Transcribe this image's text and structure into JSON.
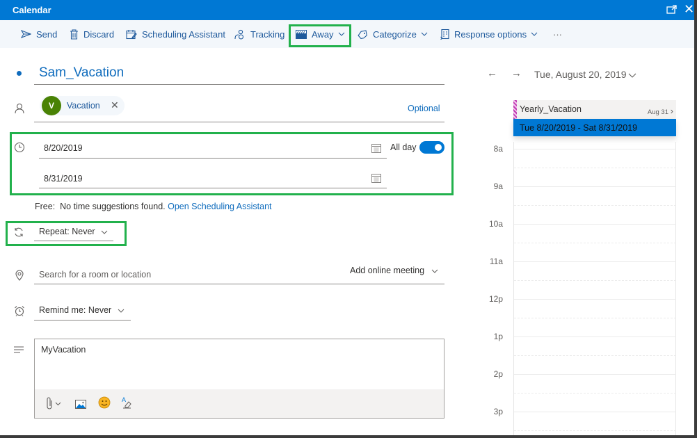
{
  "window": {
    "title": "Calendar",
    "popout_icon": "popout-icon",
    "close_icon": "close-icon",
    "close_glyph": "✕"
  },
  "toolbar": {
    "send": "Send",
    "discard": "Discard",
    "scheduling_assistant": "Scheduling Assistant",
    "tracking": "Tracking",
    "show_as": "Away",
    "categorize": "Categorize",
    "response_options": "Response options",
    "more": "···"
  },
  "event": {
    "title": "Sam_Vacation",
    "attendee": {
      "initial": "V",
      "name": "Vacation",
      "remove_glyph": "✕",
      "avatar_color": "#498205"
    },
    "optional_label": "Optional",
    "start_date": "8/20/2019",
    "end_date": "8/31/2019",
    "all_day_label": "All day",
    "all_day": true,
    "free_label": "Free:",
    "suggestions_text": "No time suggestions found.",
    "open_assistant_link": "Open Scheduling Assistant",
    "repeat": "Repeat: Never",
    "location_placeholder": "Search for a room or location",
    "online_meeting": "Add online meeting",
    "reminder": "Remind me: Never",
    "body": "MyVacation"
  },
  "calendar_pane": {
    "back_glyph": "←",
    "forward_glyph": "→",
    "date": "Tue, August 20, 2019",
    "date_chevron": "⌄",
    "all_day_event": {
      "name": "Yearly_Vacation",
      "end": "Aug 31",
      "chevron": "›"
    },
    "selected_range": "Tue 8/20/2019 - Sat 8/31/2019",
    "hours": [
      "8a",
      "9a",
      "10a",
      "11a",
      "12p",
      "1p",
      "2p",
      "3p"
    ]
  },
  "colors": {
    "accent": "#0078d4",
    "link": "#0f6cbd",
    "highlight_box": "#22b14c",
    "category_stripe": "#c239b3"
  }
}
